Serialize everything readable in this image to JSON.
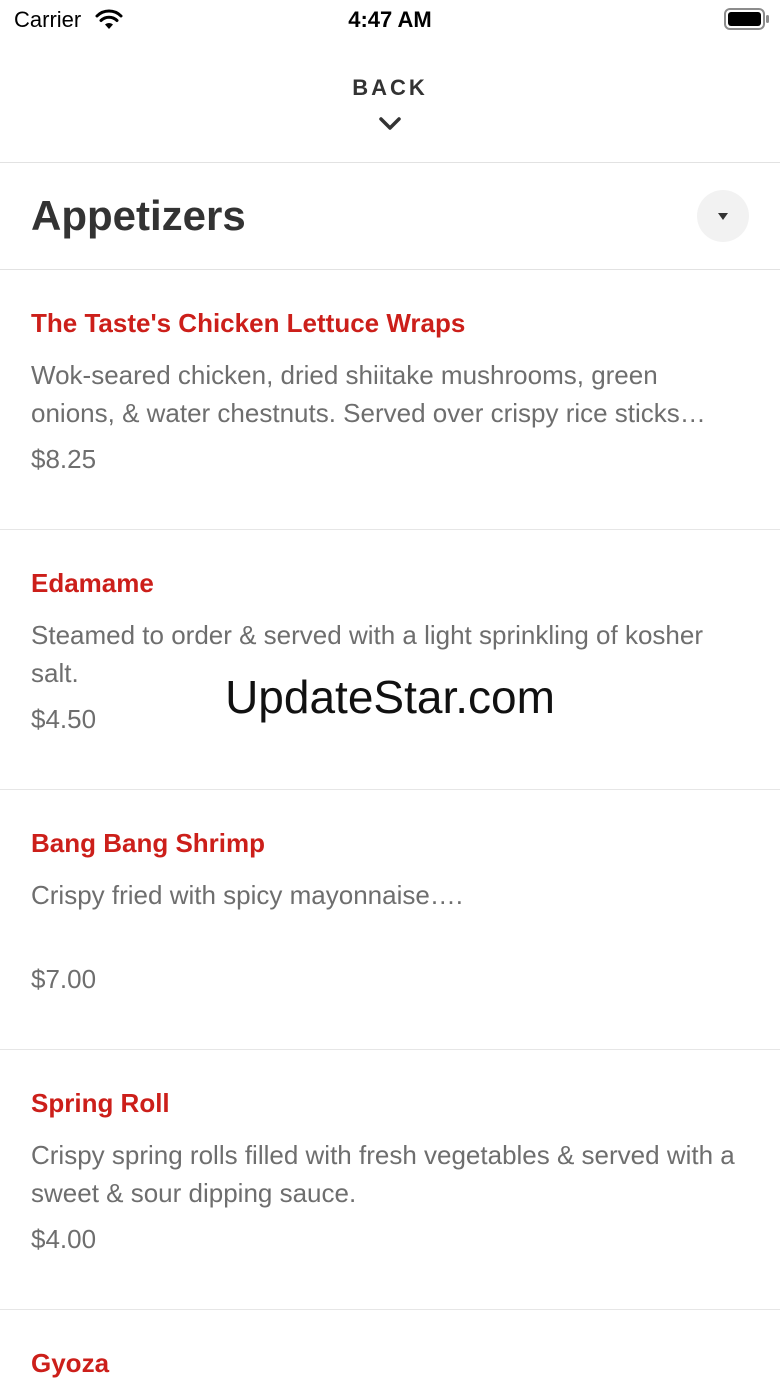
{
  "status_bar": {
    "carrier": "Carrier",
    "time": "4:47 AM"
  },
  "header": {
    "back_label": "BACK"
  },
  "section": {
    "title": "Appetizers"
  },
  "menu_items": [
    {
      "name": "The Taste's Chicken Lettuce Wraps",
      "description": "Wok-seared chicken, dried shiitake mushrooms, green onions, & water chestnuts. Served over crispy rice sticks…",
      "price": "$8.25"
    },
    {
      "name": "Edamame",
      "description": "Steamed to order & served with a light sprinkling of kosher salt.",
      "price": "$4.50"
    },
    {
      "name": "Bang Bang Shrimp",
      "description": "Crispy fried with spicy mayonnaise….",
      "price": "$7.00"
    },
    {
      "name": "Spring Roll",
      "description": "Crispy spring rolls filled with fresh vegetables & served with a sweet & sour dipping sauce.",
      "price": "$4.00"
    },
    {
      "name": "Gyoza",
      "description": "",
      "price": ""
    }
  ],
  "watermark": "UpdateStar.com",
  "colors": {
    "item_name": "#cc1f1a",
    "body_text": "#6e6e6e",
    "title_text": "#333333",
    "divider": "#e2e2e2"
  },
  "icons": {
    "wifi": "wifi-icon",
    "battery": "battery-icon",
    "back": "chevron-down-icon",
    "section_toggle": "caret-down-icon"
  }
}
